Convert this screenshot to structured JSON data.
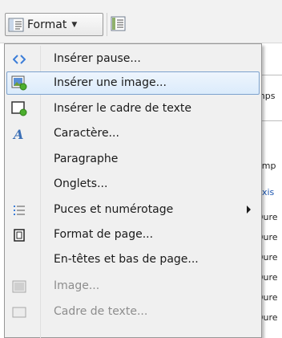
{
  "toolbar": {
    "format_label": "Format",
    "format_icon": "paragraph-format-icon",
    "dropdown_icon": "caret-down-icon",
    "secondary_icon": "styles-icon"
  },
  "background": {
    "lines": [
      "mps",
      "amp",
      "uxis",
      "Dure",
      "Dure",
      "Dure",
      "Dure",
      "Dure",
      "Dure"
    ]
  },
  "menu": {
    "items": [
      {
        "label": "Insérer pause...",
        "icon": "code-brackets-icon",
        "highlighted": false,
        "disabled": false,
        "submenu": false
      },
      {
        "label": "Insérer une image...",
        "icon": "insert-image-icon",
        "highlighted": true,
        "disabled": false,
        "submenu": false
      },
      {
        "label": "Insérer le cadre de texte",
        "icon": "insert-frame-icon",
        "highlighted": false,
        "disabled": false,
        "submenu": false
      },
      {
        "label": "Caractère...",
        "icon": "character-icon",
        "highlighted": false,
        "disabled": false,
        "submenu": false
      },
      {
        "label": "Paragraphe",
        "icon": "",
        "highlighted": false,
        "disabled": false,
        "submenu": false
      },
      {
        "label": "Onglets...",
        "icon": "",
        "highlighted": false,
        "disabled": false,
        "submenu": false
      },
      {
        "label": "Puces et numérotage",
        "icon": "bullet-list-icon",
        "highlighted": false,
        "disabled": false,
        "submenu": true
      },
      {
        "label": "Format de page...",
        "icon": "page-format-icon",
        "highlighted": false,
        "disabled": false,
        "submenu": false
      },
      {
        "label": "En-têtes et bas de page...",
        "icon": "",
        "highlighted": false,
        "disabled": false,
        "submenu": false
      },
      {
        "label": "Image...",
        "icon": "image-icon",
        "highlighted": false,
        "disabled": true,
        "submenu": false
      },
      {
        "label": "Cadre de texte...",
        "icon": "text-frame-icon",
        "highlighted": false,
        "disabled": true,
        "submenu": false
      }
    ]
  },
  "colors": {
    "highlight_border": "#7da2ce",
    "disabled_text": "#8d8d8d",
    "accent_blue": "#3b7dd8",
    "accent_green": "#4caf2e"
  }
}
